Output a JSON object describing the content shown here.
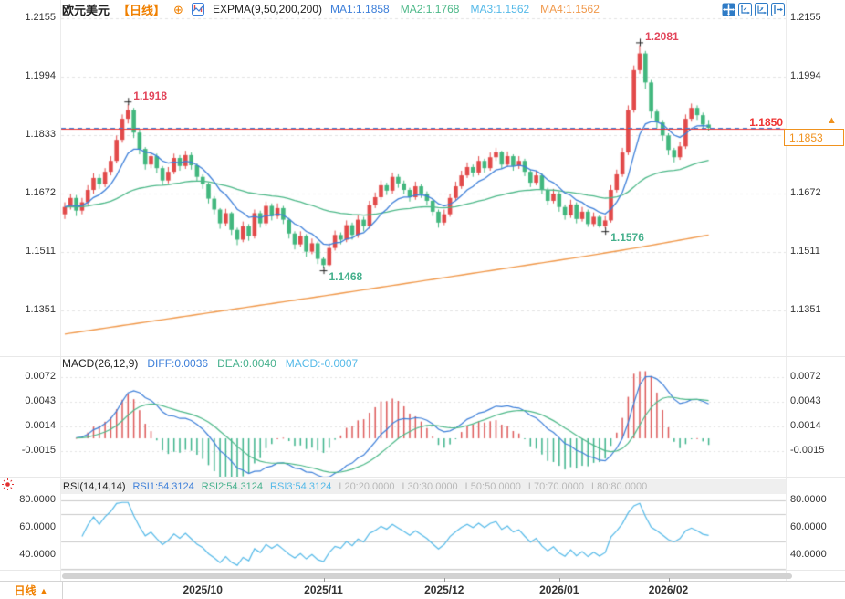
{
  "header": {
    "symbol": "欧元美元",
    "period": "【日线】",
    "indicator_label": "EXPMA(9,50,200,200)",
    "ma_values": [
      {
        "label": "MA1:1.1858",
        "color": "#3d7fd9"
      },
      {
        "label": "MA2:1.1768",
        "color": "#4cb888"
      },
      {
        "label": "MA3:1.1562",
        "color": "#54b9e8"
      },
      {
        "label": "MA4:1.1562",
        "color": "#f0984a"
      }
    ]
  },
  "price_line": {
    "label": "1.1850",
    "box_label": "1.1853"
  },
  "macd": {
    "title": "MACD(26,12,9)",
    "items": [
      {
        "label": "DIFF:0.0036",
        "color": "#3d7fd9"
      },
      {
        "label": "DEA:0.0040",
        "color": "#45b08c"
      },
      {
        "label": "MACD:-0.0007",
        "color": "#54b9e8"
      }
    ]
  },
  "rsi": {
    "title": "RSI(14,14,14)",
    "items": [
      {
        "label": "RSI1:54.3124",
        "color": "#3d7fd9"
      },
      {
        "label": "RSI2:54.3124",
        "color": "#45b08c"
      },
      {
        "label": "RSI3:54.3124",
        "color": "#54b9e8"
      },
      {
        "label": "L20:20.0000",
        "color": "#b8b8b8"
      },
      {
        "label": "L30:30.0000",
        "color": "#b8b8b8"
      },
      {
        "label": "L50:50.0000",
        "color": "#b8b8b8"
      },
      {
        "label": "L70:70.0000",
        "color": "#b8b8b8"
      },
      {
        "label": "L80:80.0000",
        "color": "#b8b8b8"
      }
    ]
  },
  "footer": {
    "period_label": "日线",
    "triangle": "▲"
  },
  "colors": {
    "up": "#e24a4a",
    "down": "#42b77e",
    "ema9": "#3d7fd9",
    "ema50": "#4cb888",
    "ema200": "#f0984a",
    "macd_pos": "#dd5a5a",
    "macd_neg": "#3eb48c",
    "rsi_line": "#54b9e8",
    "annotation_high": "#e2455a",
    "annotation_low": "#45b08c",
    "price_line_red": "#ee3333",
    "price_line_blue": "#3d7fd9",
    "grid": "#e2e2e2",
    "rsi_grid": "#c8c8c8"
  },
  "chart_data": {
    "type": "candlestick",
    "title": "欧元美元 日线 (EUR/USD Daily)",
    "x_axis_months": [
      {
        "label": "2025/10",
        "index": 24
      },
      {
        "label": "2025/11",
        "index": 45
      },
      {
        "label": "2025/12",
        "index": 66
      },
      {
        "label": "2026/01",
        "index": 86
      },
      {
        "label": "2026/02",
        "index": 105
      }
    ],
    "price_panel": {
      "yticks": [
        1.2155,
        1.1994,
        1.1833,
        1.1672,
        1.1511,
        1.1351
      ],
      "current_price_line": 1.185,
      "last_price": 1.1853,
      "ema_periods": [
        9,
        50,
        200,
        200
      ],
      "ema200_anchor_points": [
        [
          0,
          1.1285
        ],
        [
          15,
          1.132
        ],
        [
          30,
          1.1355
        ],
        [
          45,
          1.139
        ],
        [
          60,
          1.1426
        ],
        [
          75,
          1.1462
        ],
        [
          90,
          1.1498
        ],
        [
          100,
          1.1524
        ],
        [
          112,
          1.1558
        ]
      ],
      "annotations": [
        {
          "text": "1.1918",
          "index": 11,
          "kind": "high"
        },
        {
          "text": "1.2081",
          "index": 100,
          "kind": "high"
        },
        {
          "text": "1.1468",
          "index": 45,
          "kind": "low"
        },
        {
          "text": "1.1576",
          "index": 94,
          "kind": "low"
        }
      ],
      "candles": [
        [
          1.1615,
          1.1648,
          1.1602,
          1.1635
        ],
        [
          1.1635,
          1.1672,
          1.1628,
          1.166
        ],
        [
          1.166,
          1.1668,
          1.161,
          1.1625
        ],
        [
          1.1625,
          1.166,
          1.1615,
          1.1648
        ],
        [
          1.1648,
          1.1695,
          1.164,
          1.1682
        ],
        [
          1.1682,
          1.1728,
          1.1672,
          1.1715
        ],
        [
          1.1715,
          1.1725,
          1.1685,
          1.1698
        ],
        [
          1.1698,
          1.1742,
          1.169,
          1.1732
        ],
        [
          1.1732,
          1.1775,
          1.1722,
          1.1762
        ],
        [
          1.1762,
          1.1832,
          1.1755,
          1.182
        ],
        [
          1.182,
          1.189,
          1.1812,
          1.1878
        ],
        [
          1.1878,
          1.1918,
          1.1865,
          1.1902
        ],
        [
          1.1902,
          1.1908,
          1.1825,
          1.184
        ],
        [
          1.184,
          1.1848,
          1.178,
          1.1795
        ],
        [
          1.1795,
          1.18,
          1.1738,
          1.1752
        ],
        [
          1.1752,
          1.1788,
          1.1742,
          1.1775
        ],
        [
          1.1775,
          1.1782,
          1.1728,
          1.1742
        ],
        [
          1.1742,
          1.1748,
          1.1695,
          1.1708
        ],
        [
          1.1708,
          1.1745,
          1.17,
          1.1732
        ],
        [
          1.1732,
          1.1782,
          1.1725,
          1.177
        ],
        [
          1.177,
          1.1778,
          1.1735,
          1.1748
        ],
        [
          1.1748,
          1.179,
          1.174,
          1.1778
        ],
        [
          1.1778,
          1.1785,
          1.1738,
          1.175
        ],
        [
          1.175,
          1.1755,
          1.1705,
          1.1718
        ],
        [
          1.1718,
          1.1725,
          1.1685,
          1.1698
        ],
        [
          1.1698,
          1.1702,
          1.1645,
          1.1658
        ],
        [
          1.1658,
          1.1665,
          1.1615,
          1.1628
        ],
        [
          1.1628,
          1.1632,
          1.1575,
          1.159
        ],
        [
          1.159,
          1.163,
          1.1582,
          1.1618
        ],
        [
          1.1618,
          1.1622,
          1.1558,
          1.1572
        ],
        [
          1.1572,
          1.1578,
          1.153,
          1.1545
        ],
        [
          1.1545,
          1.1595,
          1.1538,
          1.1582
        ],
        [
          1.1582,
          1.1588,
          1.1542,
          1.1555
        ],
        [
          1.1555,
          1.1628,
          1.1548,
          1.1618
        ],
        [
          1.1618,
          1.1625,
          1.1578,
          1.159
        ],
        [
          1.159,
          1.165,
          1.1582,
          1.1638
        ],
        [
          1.1638,
          1.1645,
          1.1598,
          1.161
        ],
        [
          1.161,
          1.1645,
          1.1602,
          1.1632
        ],
        [
          1.1632,
          1.1638,
          1.1588,
          1.16
        ],
        [
          1.16,
          1.1605,
          1.1548,
          1.1562
        ],
        [
          1.1562,
          1.1568,
          1.1518,
          1.1532
        ],
        [
          1.1532,
          1.1568,
          1.1525,
          1.1555
        ],
        [
          1.1555,
          1.156,
          1.1498,
          1.1512
        ],
        [
          1.1512,
          1.1548,
          1.1505,
          1.1535
        ],
        [
          1.1535,
          1.154,
          1.1478,
          1.1492
        ],
        [
          1.1492,
          1.1498,
          1.1468,
          1.1475
        ],
        [
          1.1475,
          1.1535,
          1.1472,
          1.1522
        ],
        [
          1.1522,
          1.157,
          1.1515,
          1.1558
        ],
        [
          1.1558,
          1.1565,
          1.1532,
          1.1545
        ],
        [
          1.1545,
          1.1598,
          1.1538,
          1.1585
        ],
        [
          1.1585,
          1.1592,
          1.1545,
          1.1558
        ],
        [
          1.1558,
          1.1612,
          1.155,
          1.16
        ],
        [
          1.16,
          1.1608,
          1.1568,
          1.1582
        ],
        [
          1.1582,
          1.1652,
          1.1575,
          1.164
        ],
        [
          1.164,
          1.1675,
          1.1632,
          1.1662
        ],
        [
          1.1662,
          1.1708,
          1.1655,
          1.1695
        ],
        [
          1.1695,
          1.1702,
          1.1668,
          1.168
        ],
        [
          1.168,
          1.173,
          1.1672,
          1.1718
        ],
        [
          1.1718,
          1.1725,
          1.1688,
          1.17
        ],
        [
          1.17,
          1.1708,
          1.167,
          1.1682
        ],
        [
          1.1682,
          1.1688,
          1.165,
          1.1662
        ],
        [
          1.1662,
          1.1705,
          1.1655,
          1.1692
        ],
        [
          1.1692,
          1.1698,
          1.166,
          1.1672
        ],
        [
          1.1672,
          1.1678,
          1.164,
          1.1652
        ],
        [
          1.1652,
          1.1658,
          1.161,
          1.1622
        ],
        [
          1.1622,
          1.1628,
          1.1578,
          1.1592
        ],
        [
          1.1592,
          1.1628,
          1.1585,
          1.1615
        ],
        [
          1.1615,
          1.1672,
          1.1608,
          1.166
        ],
        [
          1.166,
          1.1705,
          1.1652,
          1.1692
        ],
        [
          1.1692,
          1.1735,
          1.1685,
          1.1722
        ],
        [
          1.1722,
          1.1758,
          1.1715,
          1.1745
        ],
        [
          1.1745,
          1.1752,
          1.1718,
          1.173
        ],
        [
          1.173,
          1.1775,
          1.1722,
          1.1762
        ],
        [
          1.1762,
          1.1768,
          1.173,
          1.1742
        ],
        [
          1.1742,
          1.1785,
          1.1735,
          1.1772
        ],
        [
          1.1772,
          1.1798,
          1.1762,
          1.1786
        ],
        [
          1.1786,
          1.179,
          1.174,
          1.1752
        ],
        [
          1.1752,
          1.1788,
          1.1745,
          1.1775
        ],
        [
          1.1775,
          1.178,
          1.1735,
          1.1748
        ],
        [
          1.1748,
          1.1775,
          1.174,
          1.1762
        ],
        [
          1.1762,
          1.1768,
          1.172,
          1.1732
        ],
        [
          1.1732,
          1.1738,
          1.169,
          1.1702
        ],
        [
          1.1702,
          1.1735,
          1.1695,
          1.1722
        ],
        [
          1.1722,
          1.1728,
          1.167,
          1.1682
        ],
        [
          1.1682,
          1.1688,
          1.164,
          1.1652
        ],
        [
          1.1652,
          1.1685,
          1.1645,
          1.1672
        ],
        [
          1.1672,
          1.1678,
          1.1622,
          1.1635
        ],
        [
          1.1635,
          1.1642,
          1.16,
          1.1612
        ],
        [
          1.1612,
          1.1655,
          1.1605,
          1.1642
        ],
        [
          1.1642,
          1.1648,
          1.159,
          1.1602
        ],
        [
          1.1602,
          1.1635,
          1.1595,
          1.1622
        ],
        [
          1.1622,
          1.1628,
          1.158,
          1.1588
        ],
        [
          1.1588,
          1.162,
          1.158,
          1.1608
        ],
        [
          1.1608,
          1.1612,
          1.1578,
          1.1582
        ],
        [
          1.1582,
          1.161,
          1.1576,
          1.1598
        ],
        [
          1.1598,
          1.1695,
          1.1592,
          1.1682
        ],
        [
          1.1682,
          1.1738,
          1.1675,
          1.1725
        ],
        [
          1.1725,
          1.1798,
          1.1718,
          1.1785
        ],
        [
          1.1785,
          1.1915,
          1.1778,
          1.1902
        ],
        [
          1.1902,
          1.2025,
          1.1895,
          1.2012
        ],
        [
          1.2012,
          1.2081,
          1.2002,
          1.2058
        ],
        [
          1.2058,
          1.2065,
          1.196,
          1.1978
        ],
        [
          1.1978,
          1.1985,
          1.188,
          1.1898
        ],
        [
          1.1898,
          1.1905,
          1.1852,
          1.1868
        ],
        [
          1.1868,
          1.1875,
          1.1818,
          1.1832
        ],
        [
          1.1832,
          1.1838,
          1.1778,
          1.1792
        ],
        [
          1.1792,
          1.1798,
          1.1758,
          1.1772
        ],
        [
          1.1772,
          1.1815,
          1.1765,
          1.1802
        ],
        [
          1.1802,
          1.189,
          1.1795,
          1.1878
        ],
        [
          1.1878,
          1.192,
          1.187,
          1.1908
        ],
        [
          1.1908,
          1.1915,
          1.1875,
          1.1888
        ],
        [
          1.1888,
          1.1895,
          1.185,
          1.1862
        ],
        [
          1.1862,
          1.1875,
          1.1845,
          1.1853
        ]
      ]
    },
    "macd_panel": {
      "type": "macd",
      "params": [
        26,
        12,
        9
      ],
      "yticks": [
        0.0072,
        0.0043,
        0.0014,
        -0.0015
      ],
      "diff": 0.0036,
      "dea": 0.004,
      "macd": -0.0007
    },
    "rsi_panel": {
      "type": "rsi",
      "params": [
        14,
        14,
        14
      ],
      "yticks": [
        80,
        60,
        40
      ],
      "levels": [
        80,
        70,
        50,
        30
      ],
      "rsi1": 54.3124,
      "rsi2": 54.3124,
      "rsi3": 54.3124
    }
  }
}
